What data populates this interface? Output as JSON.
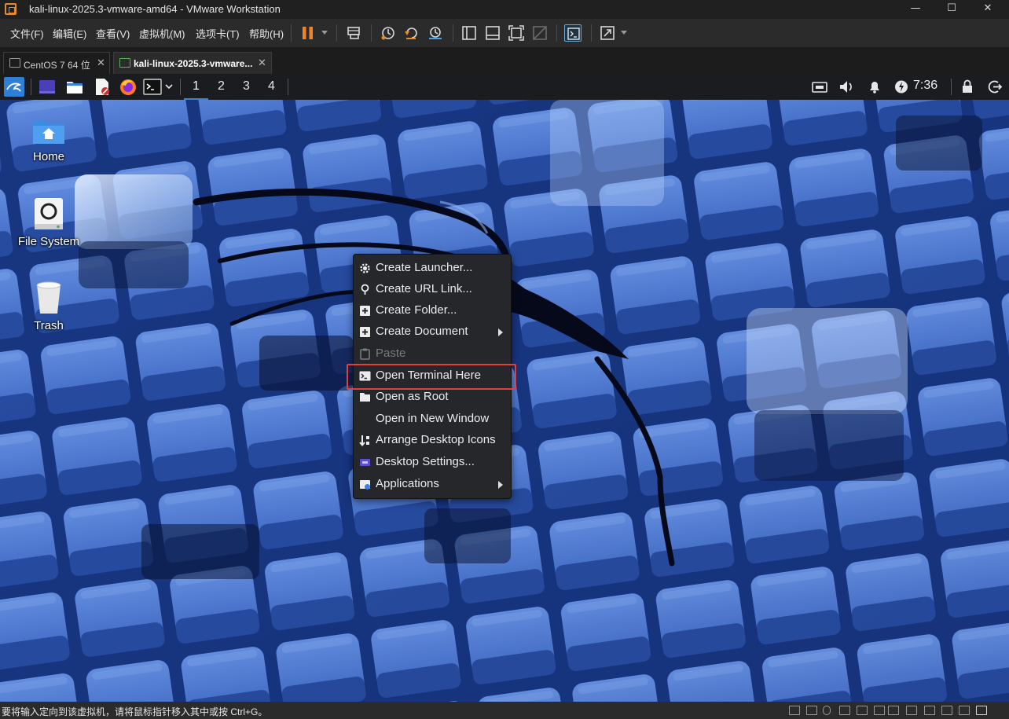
{
  "window": {
    "title": "kali-linux-2025.3-vmware-amd64 - VMware Workstation",
    "minimize": "—",
    "maximize": "☐",
    "close": "✕"
  },
  "menu": {
    "items": [
      "文件(F)",
      "编辑(E)",
      "查看(V)",
      "虚拟机(M)",
      "选项卡(T)",
      "帮助(H)"
    ]
  },
  "vm_tabs": [
    {
      "label": "CentOS 7 64 位",
      "close": "✕",
      "active": false
    },
    {
      "label": "kali-linux-2025.3-vmware...",
      "close": "✕",
      "active": true
    }
  ],
  "kali_panel": {
    "workspaces": [
      "1",
      "2",
      "3",
      "4"
    ],
    "clock": "7:36"
  },
  "desktop_icons": [
    {
      "label": "Home",
      "icon": "home-folder-icon"
    },
    {
      "label": "File System",
      "icon": "drive-icon"
    },
    {
      "label": "Trash",
      "icon": "trash-icon"
    }
  ],
  "context_menu": {
    "items": [
      {
        "label": "Create Launcher...",
        "icon": "gear-icon",
        "submenu": false,
        "disabled": false
      },
      {
        "label": "Create URL Link...",
        "icon": "link-icon",
        "submenu": false,
        "disabled": false
      },
      {
        "label": "Create Folder...",
        "icon": "new-folder-icon",
        "submenu": false,
        "disabled": false
      },
      {
        "label": "Create Document",
        "icon": "new-document-icon",
        "submenu": true,
        "disabled": false
      },
      {
        "label": "Paste",
        "icon": "clipboard-icon",
        "submenu": false,
        "disabled": true
      },
      {
        "label": "Open Terminal Here",
        "icon": "terminal-icon",
        "submenu": false,
        "disabled": false,
        "highlighted": true
      },
      {
        "label": "Open as Root",
        "icon": "folder-icon",
        "submenu": false,
        "disabled": false
      },
      {
        "label": "Open in New Window",
        "icon": "",
        "submenu": false,
        "disabled": false
      },
      {
        "label": "Arrange Desktop Icons",
        "icon": "arrange-icon",
        "submenu": false,
        "disabled": false
      },
      {
        "label": "Desktop Settings...",
        "icon": "desktop-settings-icon",
        "submenu": false,
        "disabled": false
      },
      {
        "label": "Applications",
        "icon": "applications-icon",
        "submenu": true,
        "disabled": false
      }
    ],
    "highlight_color": "#e0413c"
  },
  "statusbar": {
    "text": "要将输入定向到该虚拟机，请将鼠标指针移入其中或按 Ctrl+G。"
  },
  "colors": {
    "vmware_orange": "#e8892a",
    "pause_orange": "#f0822a",
    "kali_blue": "#3b82d6"
  }
}
